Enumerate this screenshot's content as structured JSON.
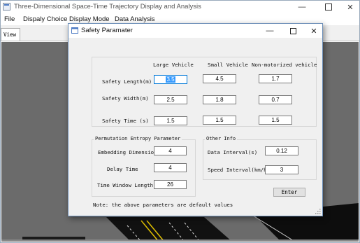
{
  "main_window": {
    "title": "Three-Dimensional Space-Time Trajectory Display and Analysis",
    "menu": [
      "File",
      "Dispaly Choice",
      "Display Mode",
      "Data Analysis"
    ],
    "tabs": [
      "View"
    ]
  },
  "dialog": {
    "title": "Safety Paramater",
    "column_headers": [
      "Large Vehicle",
      "Small Vehicle",
      "Non-motorized vehicle"
    ],
    "rows": [
      {
        "label": "Safety Length(m)",
        "values": [
          "3.5",
          "4.5",
          "1.7"
        ]
      },
      {
        "label": "Safety Width(m)",
        "values": [
          "2.5",
          "1.8",
          "0.7"
        ]
      },
      {
        "label": "Safety Time (s)",
        "values": [
          "1.5",
          "1.5",
          "1.5"
        ]
      }
    ],
    "entropy_group": {
      "title": "Permutation Entropy Parameter",
      "fields": [
        {
          "label": "Embedding Dimension",
          "value": "4"
        },
        {
          "label": "Delay Time",
          "value": "4"
        },
        {
          "label": "Time Window Length",
          "value": "26"
        }
      ]
    },
    "other_group": {
      "title": "Other Info",
      "fields": [
        {
          "label": "Data Interval(s)",
          "value": "0.12"
        },
        {
          "label": "Speed Interval(km/h)",
          "value": "3"
        }
      ]
    },
    "enter_label": "Enter",
    "note": "Note: the above parameters are default values"
  },
  "icons": {
    "minimize": "minimize-icon",
    "maximize": "maximize-icon",
    "close": "close-icon",
    "dialog_app": "dialog-app-icon"
  },
  "colors": {
    "selection": "#3399ff",
    "focus_border": "#0078d7",
    "dialog_border": "#6d8fb8",
    "viewport_bg": "#6b6b6b"
  }
}
